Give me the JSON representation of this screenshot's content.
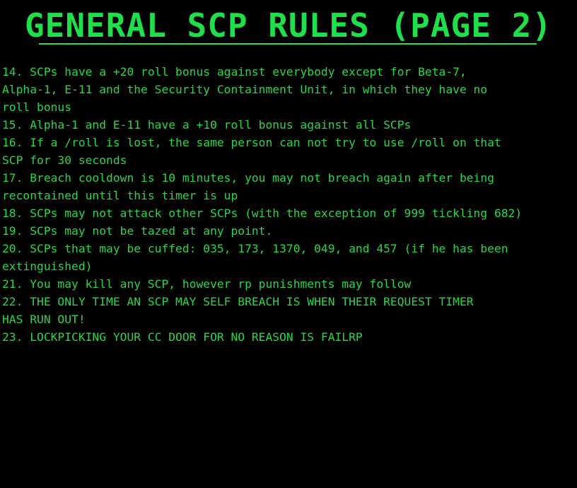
{
  "page": {
    "title": "GENERAL SCP RULES (PAGE 2)",
    "accent_color": "#1fe04a",
    "background_color": "#000000"
  },
  "rules": [
    {
      "lines": [
        "14. SCPs have a +20 roll bonus against everybody except for Beta-7,",
        "Alpha-1, E-11 and the Security Containment Unit, in which they have no",
        "roll bonus"
      ]
    },
    {
      "lines": [
        "15. Alpha-1 and E-11 have a +10 roll bonus against all SCPs"
      ]
    },
    {
      "lines": [
        "16. If a /roll is lost, the same person can not try to use /roll on that",
        "SCP for 30 seconds"
      ]
    },
    {
      "lines": [
        "17. Breach cooldown is 10 minutes, you may not breach again after being",
        "recontained until this timer is up"
      ]
    },
    {
      "lines": [
        "18. SCPs may not attack other SCPs (with the exception of 999 tickling 682)"
      ]
    },
    {
      "lines": [
        "19. SCPs may not be tazed at any point."
      ]
    },
    {
      "lines": [
        "20. SCPs that may be cuffed: 035, 173, 1370, 049, and 457 (if he has been",
        "extinguished)"
      ]
    },
    {
      "lines": [
        "21. You may kill any SCP, however rp punishments may follow"
      ]
    },
    {
      "lines": [
        "22. THE ONLY TIME AN SCP MAY SELF BREACH IS WHEN THEIR REQUEST TIMER",
        "HAS RUN OUT!"
      ]
    },
    {
      "lines": [
        "23. LOCKPICKING YOUR CC DOOR FOR NO REASON IS FAILRP"
      ]
    }
  ]
}
